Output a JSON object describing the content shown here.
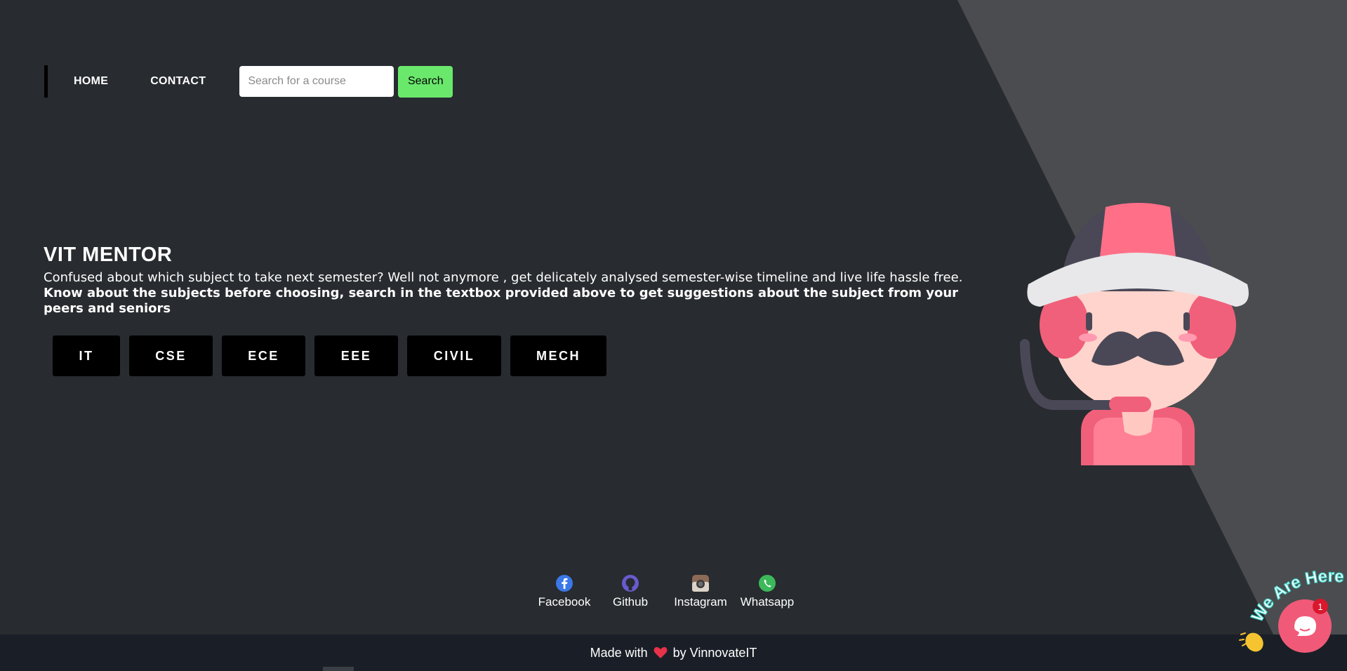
{
  "nav": {
    "home_label": "HOME",
    "contact_label": "CONTACT",
    "search_placeholder": "Search for a course",
    "search_button_label": "Search"
  },
  "hero": {
    "title": "VIT MENTOR",
    "description": "Confused about which subject to take next semester? Well not anymore , get delicately analysed semester-wise timeline and live life hassle free.",
    "bold_description": "Know about the subjects before choosing, search in the textbox provided above to get suggestions about the subject from your peers and seniors"
  },
  "branches": [
    {
      "label": "IT"
    },
    {
      "label": "CSE"
    },
    {
      "label": "ECE"
    },
    {
      "label": "EEE"
    },
    {
      "label": "CIVIL"
    },
    {
      "label": "MECH"
    }
  ],
  "social": [
    {
      "label": "Facebook",
      "icon": "facebook-icon"
    },
    {
      "label": "Github",
      "icon": "github-icon"
    },
    {
      "label": "Instagram",
      "icon": "instagram-icon"
    },
    {
      "label": "Whatsapp",
      "icon": "whatsapp-icon"
    }
  ],
  "footer": {
    "prefix": "Made with",
    "suffix": "by VinnovateIT",
    "heart_icon": "heart-icon"
  },
  "chat": {
    "banner_text": "We Are Here!",
    "badge_count": "1",
    "icon": "chat-bubble-icon",
    "wave_icon": "waving-hand-icon"
  },
  "colors": {
    "background": "#282b2f",
    "diagonal_panel": "#4b4c4f",
    "search_button": "#6ae86c",
    "branch_button": "#000000",
    "footer": "#1a1f27",
    "chat_accent": "#f05a78"
  }
}
